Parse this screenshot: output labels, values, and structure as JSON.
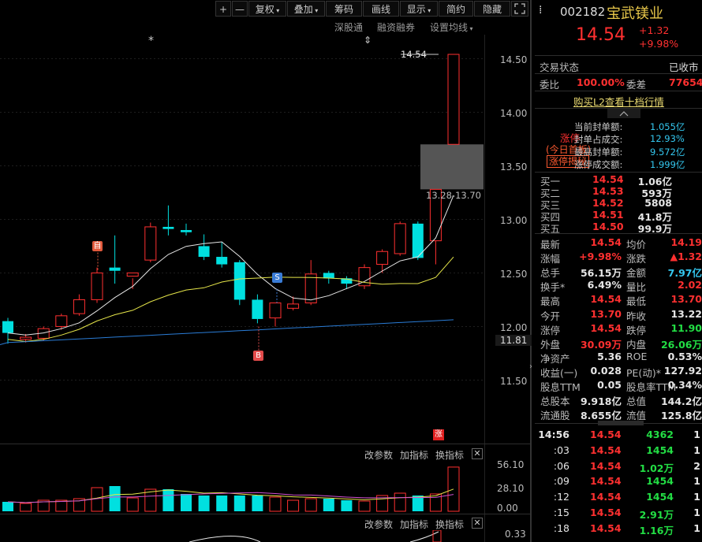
{
  "toolbar": {
    "zoom_in": "+",
    "zoom_out": "—",
    "fuquan": "复权",
    "diejia": "叠加",
    "chouma": "筹码",
    "huaxian": "画线",
    "xianshi": "显示",
    "jianyue": "简约",
    "yincang": "隐藏",
    "fullscreen_icon": "expand-icon"
  },
  "subbar": {
    "shengutong": "深股通",
    "rongzi": "融资融券",
    "setting_ma": "设置均线"
  },
  "price_axis": [
    "14.50",
    "14.00",
    "13.50",
    "13.00",
    "12.50",
    "12.00",
    "11.81",
    "11.50"
  ],
  "chart_labels": {
    "high_label": "14.54",
    "zone_label": "13.28-13.70",
    "marker_zi": "自",
    "marker_s": "S",
    "marker_b": "B",
    "marker_zhang": "涨",
    "asterisk": "*",
    "arrow": "⇕"
  },
  "indicator_bar1": {
    "change": "改参数",
    "add": "加指标",
    "switch": "换指标"
  },
  "vol_axis": [
    "56.10",
    "28.10",
    "0.00"
  ],
  "indicator_bar2": {
    "change": "改参数",
    "add": "加指标",
    "switch": "换指标"
  },
  "ind2_axis": "0.33",
  "stock": {
    "code": "002182",
    "name": "宝武镁业",
    "price": "14.54",
    "change": "+1.32",
    "change_pct": "+9.98%",
    "status_label": "交易状态",
    "status_value": "已收市",
    "weibi_label": "委比",
    "weibi_value": "100.00%",
    "weicha_label": "委差",
    "weicha_value": "77654",
    "l2_link": "购买L2查看十档行情"
  },
  "limit_up": {
    "title": "涨停",
    "sub": "(今日首板)",
    "reveal": "涨停揭秘",
    "lines": [
      {
        "label": "当前封单额:",
        "value": "1.055亿"
      },
      {
        "label": "封单占成交:",
        "value": "12.93%"
      },
      {
        "label": "最高封单额:",
        "value": "9.572亿"
      },
      {
        "label": "涨停成交额:",
        "value": "1.999亿"
      }
    ]
  },
  "bids": [
    {
      "label": "买一",
      "price": "14.54",
      "vol": "1.06亿"
    },
    {
      "label": "买二",
      "price": "14.53",
      "vol": "593万"
    },
    {
      "label": "买三",
      "price": "14.52",
      "vol": "5808"
    },
    {
      "label": "买四",
      "price": "14.51",
      "vol": "41.8万"
    },
    {
      "label": "买五",
      "price": "14.50",
      "vol": "99.9万"
    }
  ],
  "stats": [
    {
      "l1": "最新",
      "v1": "14.54",
      "c1": "red",
      "l2": "均价",
      "v2": "14.19",
      "c2": "red"
    },
    {
      "l1": "涨幅",
      "v1": "+9.98%",
      "c1": "red",
      "l2": "涨跌",
      "v2": "▲1.32",
      "c2": "red"
    },
    {
      "l1": "总手",
      "v1": "56.15万",
      "c1": "white",
      "l2": "金额",
      "v2": "7.97亿",
      "c2": "cyan"
    },
    {
      "l1": "换手*",
      "v1": "6.49%",
      "c1": "white",
      "l2": "量比",
      "v2": "2.02",
      "c2": "red"
    },
    {
      "l1": "最高",
      "v1": "14.54",
      "c1": "red",
      "l2": "最低",
      "v2": "13.70",
      "c2": "red"
    },
    {
      "l1": "今开",
      "v1": "13.70",
      "c1": "red",
      "l2": "昨收",
      "v2": "13.22",
      "c2": "white"
    },
    {
      "l1": "涨停",
      "v1": "14.54",
      "c1": "red",
      "l2": "跌停",
      "v2": "11.90",
      "c2": "green"
    },
    {
      "l1": "外盘",
      "v1": "30.09万",
      "c1": "red",
      "l2": "内盘",
      "v2": "26.06万",
      "c2": "green"
    },
    {
      "l1": "净资产",
      "v1": "5.36",
      "c1": "white",
      "l2": "ROE",
      "v2": "0.53%",
      "c2": "white"
    },
    {
      "l1": "收益(一)",
      "v1": "0.028",
      "c1": "white",
      "l2": "PE(动)*",
      "v2": "127.92",
      "c2": "white"
    },
    {
      "l1": "股息TTM",
      "v1": "0.05",
      "c1": "white",
      "l2": "股息率TTM",
      "v2": "0.34%",
      "c2": "white"
    },
    {
      "l1": "总股本",
      "v1": "9.918亿",
      "c1": "white",
      "l2": "总值",
      "v2": "144.2亿",
      "c2": "white"
    },
    {
      "l1": "流通股",
      "v1": "8.655亿",
      "c1": "white",
      "l2": "流值",
      "v2": "125.8亿",
      "c2": "white"
    }
  ],
  "ticks": [
    {
      "time": "14:56",
      "price": "14.54",
      "vol": "4362",
      "n": "1"
    },
    {
      "time": ":03",
      "price": "14.54",
      "vol": "1454",
      "n": "1"
    },
    {
      "time": ":06",
      "price": "14.54",
      "vol": "1.02万",
      "n": "2"
    },
    {
      "time": ":09",
      "price": "14.54",
      "vol": "1454",
      "n": "1"
    },
    {
      "time": ":12",
      "price": "14.54",
      "vol": "1454",
      "n": "1"
    },
    {
      "time": ":15",
      "price": "14.54",
      "vol": "2.91万",
      "n": "1"
    },
    {
      "time": ":18",
      "price": "14.54",
      "vol": "1.16万",
      "n": "1"
    }
  ],
  "colors": {
    "up": "#ff3030",
    "down": "#00e0e0",
    "ma5": "#e6e6e6",
    "ma10": "#e6e64a",
    "ma20": "#2a7cd6",
    "accent_bg": "#1a1a1a"
  },
  "chart_data": {
    "type": "candlestick",
    "ylim": [
      11.3,
      14.6
    ],
    "ohlc": [
      [
        12.05,
        12.08,
        11.84,
        11.94
      ],
      [
        11.88,
        11.93,
        11.85,
        11.9
      ],
      [
        11.89,
        12.0,
        11.87,
        11.98
      ],
      [
        12.0,
        12.12,
        11.97,
        12.1
      ],
      [
        12.12,
        12.3,
        12.1,
        12.25
      ],
      [
        12.25,
        12.55,
        12.22,
        12.5
      ],
      [
        12.55,
        12.85,
        12.4,
        12.52
      ],
      [
        12.47,
        12.45,
        12.35,
        12.5
      ],
      [
        12.62,
        12.97,
        12.6,
        12.93
      ],
      [
        12.93,
        13.13,
        12.85,
        12.91
      ],
      [
        12.9,
        12.96,
        12.85,
        12.88
      ],
      [
        12.75,
        12.86,
        12.62,
        12.65
      ],
      [
        12.65,
        12.79,
        12.55,
        12.58
      ],
      [
        12.6,
        12.62,
        12.2,
        12.25
      ],
      [
        12.25,
        12.3,
        12.03,
        12.07
      ],
      [
        12.08,
        12.22,
        12.0,
        12.22
      ],
      [
        12.17,
        12.28,
        12.15,
        12.21
      ],
      [
        12.22,
        12.62,
        12.2,
        12.49
      ],
      [
        12.5,
        12.52,
        12.4,
        12.45
      ],
      [
        12.45,
        12.47,
        12.35,
        12.4
      ],
      [
        12.38,
        12.58,
        12.35,
        12.55
      ],
      [
        12.58,
        12.72,
        12.5,
        12.7
      ],
      [
        12.68,
        12.98,
        12.66,
        12.96
      ],
      [
        12.96,
        12.98,
        12.62,
        12.64
      ],
      [
        12.8,
        13.25,
        12.58,
        13.28
      ],
      [
        13.7,
        14.54,
        13.7,
        14.54
      ]
    ],
    "volume": [
      12,
      10,
      14,
      14,
      16,
      30,
      32,
      17,
      28,
      28,
      22,
      20,
      20,
      20,
      20,
      18,
      14,
      16,
      16,
      14,
      13,
      20,
      23,
      20,
      22,
      56.1
    ],
    "vol_ylim": [
      0,
      60
    ]
  }
}
